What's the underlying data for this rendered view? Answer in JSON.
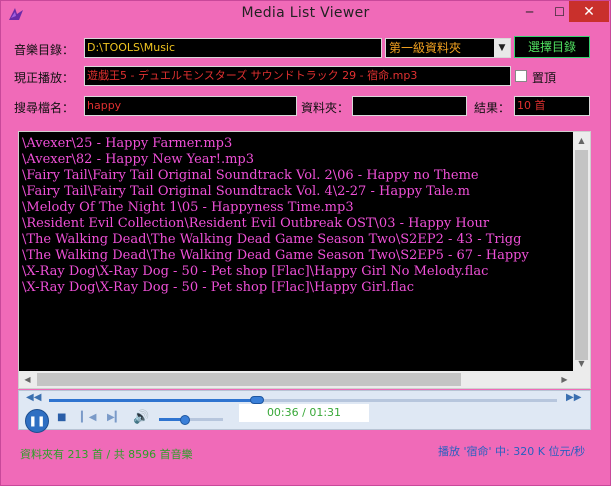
{
  "window": {
    "title": "Media List Viewer",
    "min_icon": "minimize-icon",
    "max_icon": "maximize-icon",
    "close_icon": "close-icon"
  },
  "form": {
    "dir_label": "音樂目錄：",
    "dir_value": "D:\\TOOLS\\Music",
    "level_option": "第一級資料夾",
    "select_dir_button": "選擇目錄",
    "now_playing_label": "現正播放：",
    "now_playing_value": "遊戯王5 - デュエルモンスターズ サウンドトラック 29 - 宿命.mp3",
    "pin_label": "置頂",
    "search_label": "搜尋檔名：",
    "search_value": "happy",
    "folder_label": "資料夾：",
    "folder_value": "",
    "result_label": "結果：",
    "result_value": "10 首"
  },
  "files": [
    "\\Avexer\\25 - Happy Farmer.mp3",
    "\\Avexer\\82 - Happy New Year!.mp3",
    "\\Fairy Tail\\Fairy Tail Original Soundtrack Vol. 2\\06 - Happy no Theme",
    "\\Fairy Tail\\Fairy Tail Original Soundtrack Vol. 4\\2-27 - Happy Tale.m",
    "\\Melody Of The Night 1\\05 - Happyness Time.mp3",
    "\\Resident Evil Collection\\Resident Evil Outbreak OST\\03 - Happy Hour",
    "\\The Walking Dead\\The Walking Dead Game Season Two\\S2EP2 - 43 - Trigg",
    "\\The Walking Dead\\The Walking Dead Game Season Two\\S2EP5 - 67 - Happy",
    "\\X-Ray Dog\\X-Ray Dog - 50 - Pet shop [Flac]\\Happy Girl No Melody.flac",
    "\\X-Ray Dog\\X-Ray Dog - 50 - Pet shop [Flac]\\Happy Girl.flac"
  ],
  "player": {
    "time_display": "00:36 / 01:31",
    "progress_fraction": 0.41,
    "volume_fraction": 0.4,
    "play_icon": "pause-icon"
  },
  "status": {
    "left": "資料夾有 213 首 / 共 8596 首音樂",
    "right": "播放 '宿命' 中: 320 K 位元/秒"
  }
}
